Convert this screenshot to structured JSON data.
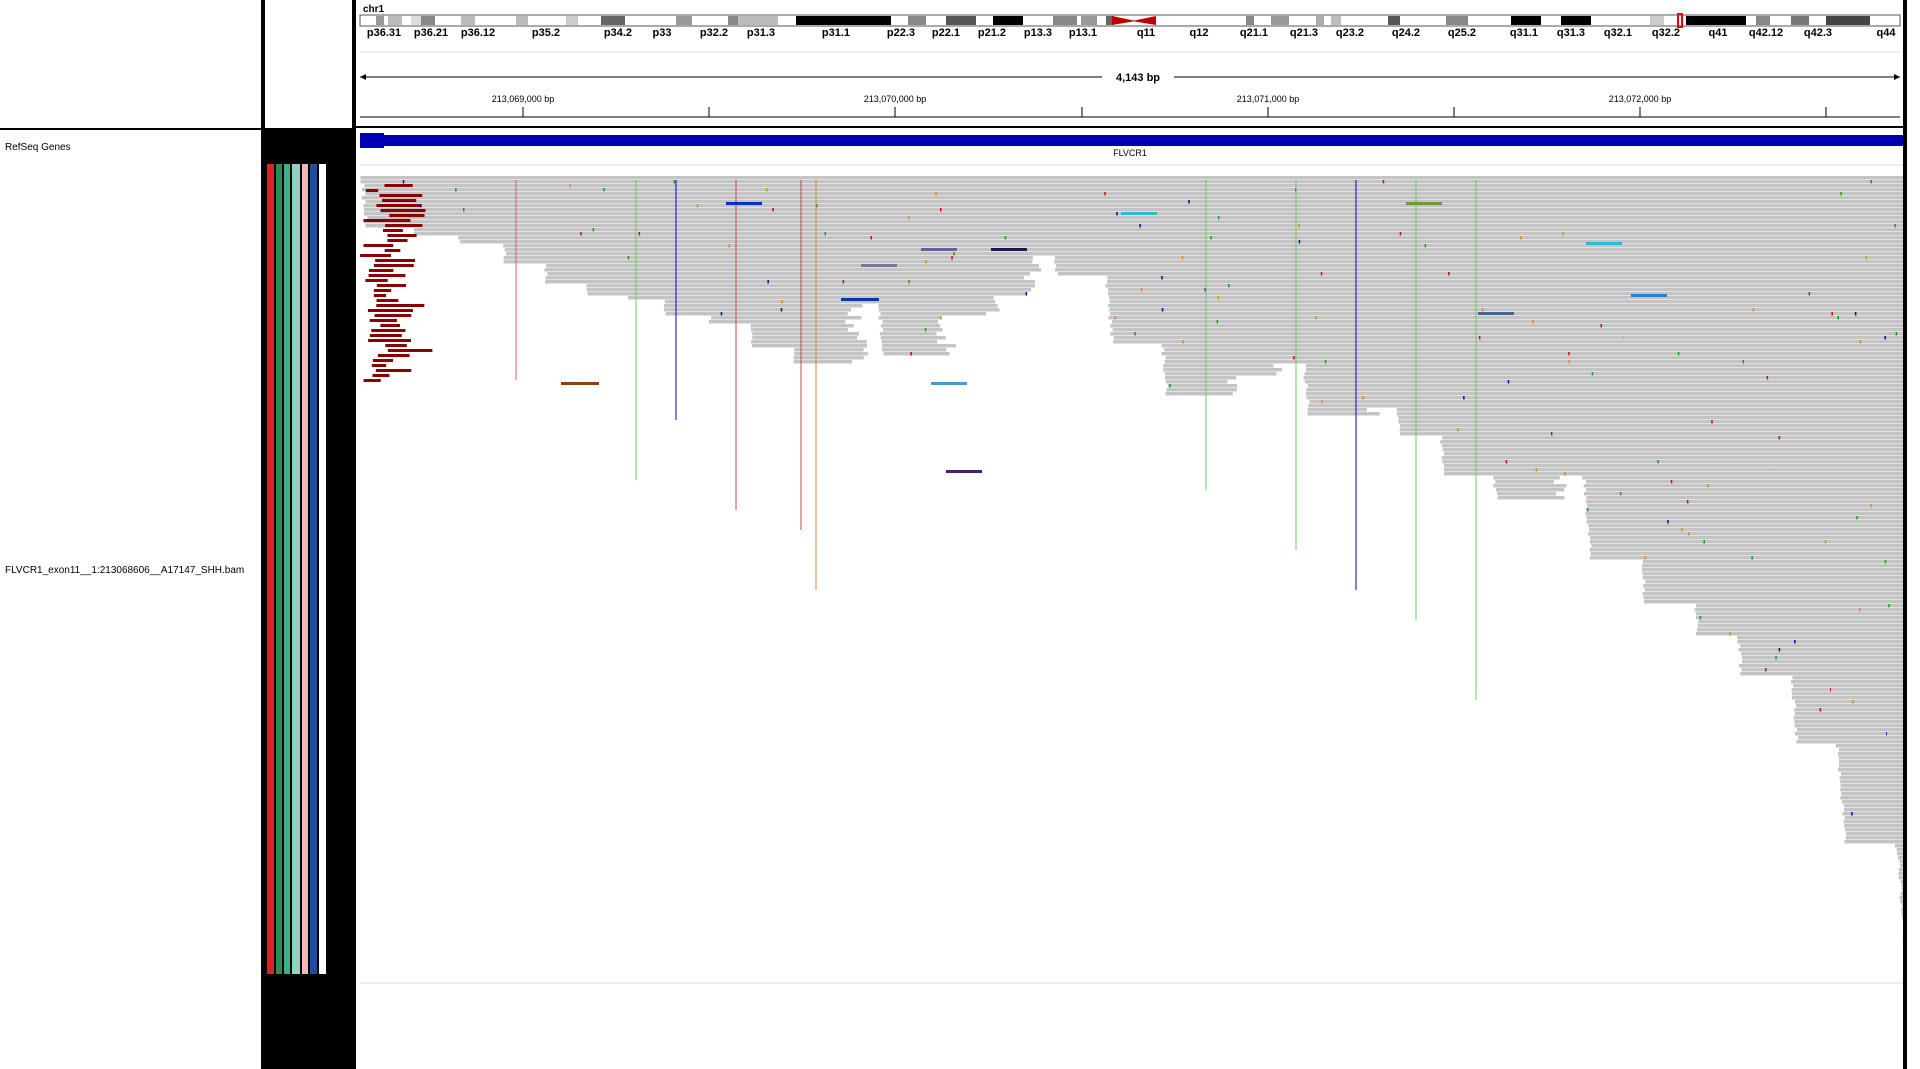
{
  "chromosome": {
    "name": "chr1",
    "bands": [
      "p36.31",
      "p36.21",
      "p36.12",
      "p35.2",
      "p34.2",
      "p33",
      "p32.2",
      "p31.3",
      "p31.1",
      "p22.3",
      "p22.1",
      "p21.2",
      "p13.3",
      "p13.1",
      "q11",
      "q12",
      "q21.1",
      "q21.3",
      "q23.2",
      "q24.2",
      "q25.2",
      "q31.1",
      "q31.3",
      "q32.1",
      "q32.2",
      "q41",
      "q42.12",
      "q42.3",
      "q44"
    ]
  },
  "ruler": {
    "span_label": "4,143 bp",
    "ticks": [
      "213,069,000 bp",
      "213,070,000 bp",
      "213,071,000 bp",
      "213,072,000 bp"
    ]
  },
  "tracks": {
    "refseq": {
      "name": "RefSeq Genes",
      "gene_label": "FLVCR1"
    },
    "alignment": {
      "name": "FLVCR1_exon11__1:213068606__A17147_SHH.bam"
    }
  },
  "colors": {
    "read": "#c4c4c4",
    "gene": "#0000b2",
    "soft_clip": "#8b0000",
    "attr_stripes": [
      "#e02020",
      "#2e8b57",
      "#3cb08a",
      "#8fd3c1",
      "#f4b6b6",
      "#1e4f9c",
      "#ffffff"
    ]
  }
}
